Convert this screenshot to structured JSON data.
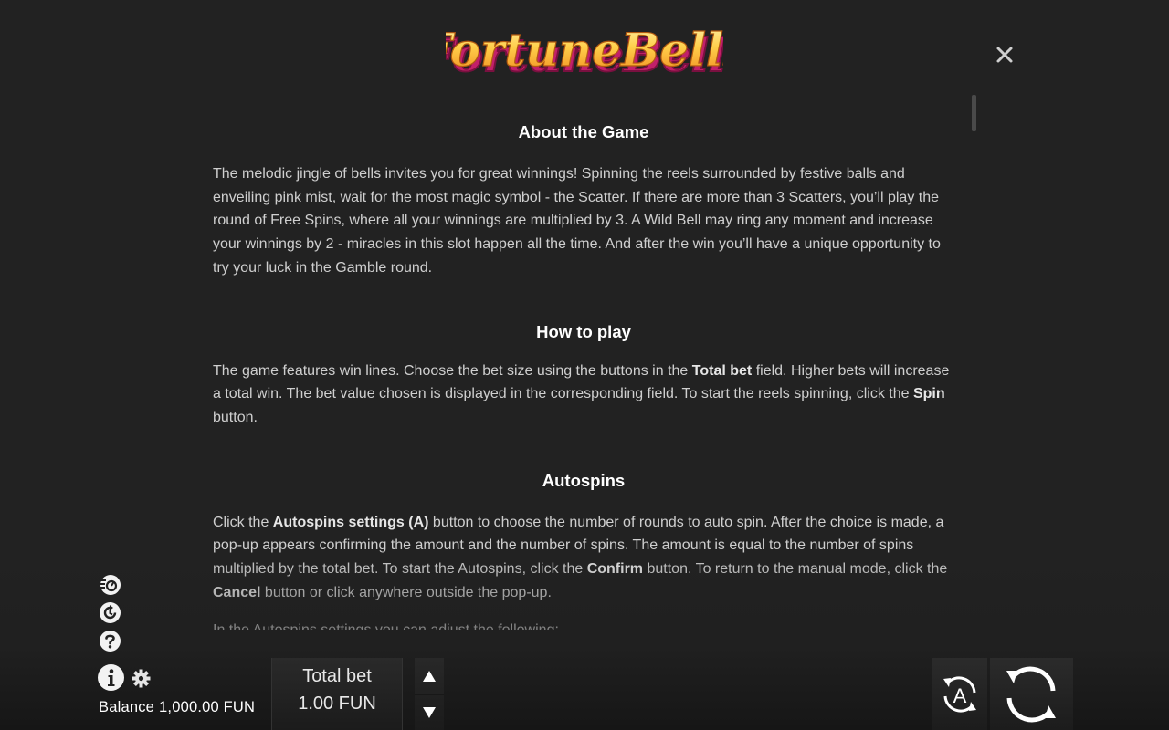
{
  "logo": {
    "text": "Fortune Bells"
  },
  "header": {
    "close_icon": "close-icon"
  },
  "help": {
    "sections": {
      "about": {
        "title": "About the Game",
        "paragraph": "The melodic jingle of bells invites you for great winnings! Spinning the reels surrounded by festive balls and enveiling pink mist, wait for the most magic symbol - the Scatter. If there are more than 3 Scatters, you’ll play the round of Free Spins, where all your winnings are multiplied by 3. A Wild Bell may ring any moment and increase your winnings by 2 - miracles in this slot happen all the time. And after the win you’ll have a unique opportunity to try your luck in the Gamble round."
      },
      "how_to_play": {
        "title": "How to play",
        "p1": "The game features win lines. Choose the bet size using the buttons in the ",
        "b1": "Total bet",
        "p2": " field. Higher bets will increase a total win. The bet value chosen is displayed in the corresponding field. To start the reels spinning, click the ",
        "b2": "Spin",
        "p3": " button."
      },
      "autospins": {
        "title": "Autospins",
        "p1": "Click the ",
        "b1": "Autospins settings (A)",
        "p2": " button to choose the number of rounds to auto spin. After the choice is made, a pop-up appears confirming the amount and the number of spins. The amount is equal to the number of spins multiplied by the total bet. To start the Autospins, click the ",
        "b2": "Confirm",
        "p3": " button. To return to the manual mode, click the ",
        "b3": "Cancel",
        "p4": " button or click anywhere outside the pop-up.",
        "p5": "In the Autospins settings you can adjust the following:"
      }
    }
  },
  "sidebar": {
    "icons": [
      "turbo-icon",
      "history-icon",
      "help-icon",
      "info-icon",
      "settings-icon"
    ]
  },
  "footer": {
    "balance_label": "Balance",
    "balance_value": "1,000.00 FUN",
    "total_bet_label": "Total bet",
    "total_bet_value": "1.00 FUN",
    "auto_label": "A"
  },
  "colors": {
    "background": "#222222",
    "heading": "#ffffff",
    "body_text": "#cfcfcf",
    "logo_gold": "#f7b733",
    "logo_pink": "#d6327a"
  }
}
